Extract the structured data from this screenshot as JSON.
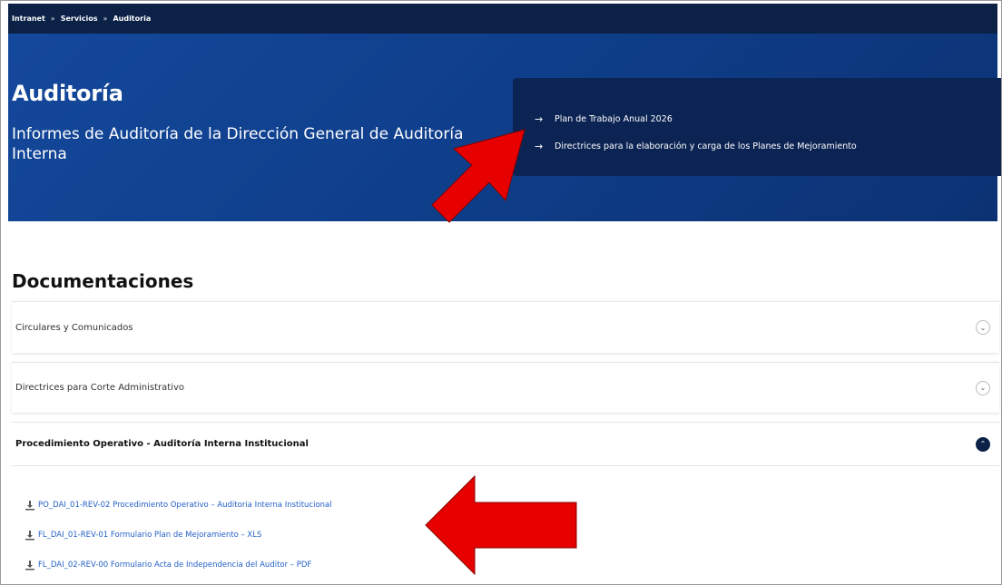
{
  "breadcrumb": {
    "items": [
      "Intranet",
      "Servicios",
      "Auditoria"
    ],
    "separator": "»"
  },
  "hero": {
    "title": "Auditoría",
    "subtitle": "Informes de Auditoría de la Dirección General de Auditoría Interna",
    "quick_links": [
      {
        "label": "Plan de Trabajo Anual 2026"
      },
      {
        "label": "Directrices para la elaboración y carga de los Planes de Mejoramiento"
      }
    ]
  },
  "section": {
    "title": "Documentaciones"
  },
  "accordion": [
    {
      "label": "Circulares y Comunicados",
      "expanded": false
    },
    {
      "label": "Directrices para Corte Administrativo",
      "expanded": false
    },
    {
      "label": "Procedimiento Operativo - Auditoría Interna Institucional",
      "expanded": true
    }
  ],
  "documents": [
    {
      "label": "PO_DAI_01-REV-02 Procedimiento Operativo – Auditoria Interna Institucional"
    },
    {
      "label": "FL_DAI_01-REV-01 Formulario Plan de Mejoramiento – XLS"
    },
    {
      "label": "FL_DAI_02-REV-00 Formulario Acta de Independencia del Auditor – PDF"
    }
  ],
  "colors": {
    "nav_bg": "#0b2146",
    "hero_bg": "#14489b",
    "quicklinks_bg": "#0c2454",
    "link": "#2461c7",
    "annotation": "#e60000"
  },
  "icons": {
    "quick_link": "arrow-right-icon",
    "collapsed": "chevron-down-icon",
    "expanded": "chevron-up-icon",
    "document": "download-icon"
  }
}
